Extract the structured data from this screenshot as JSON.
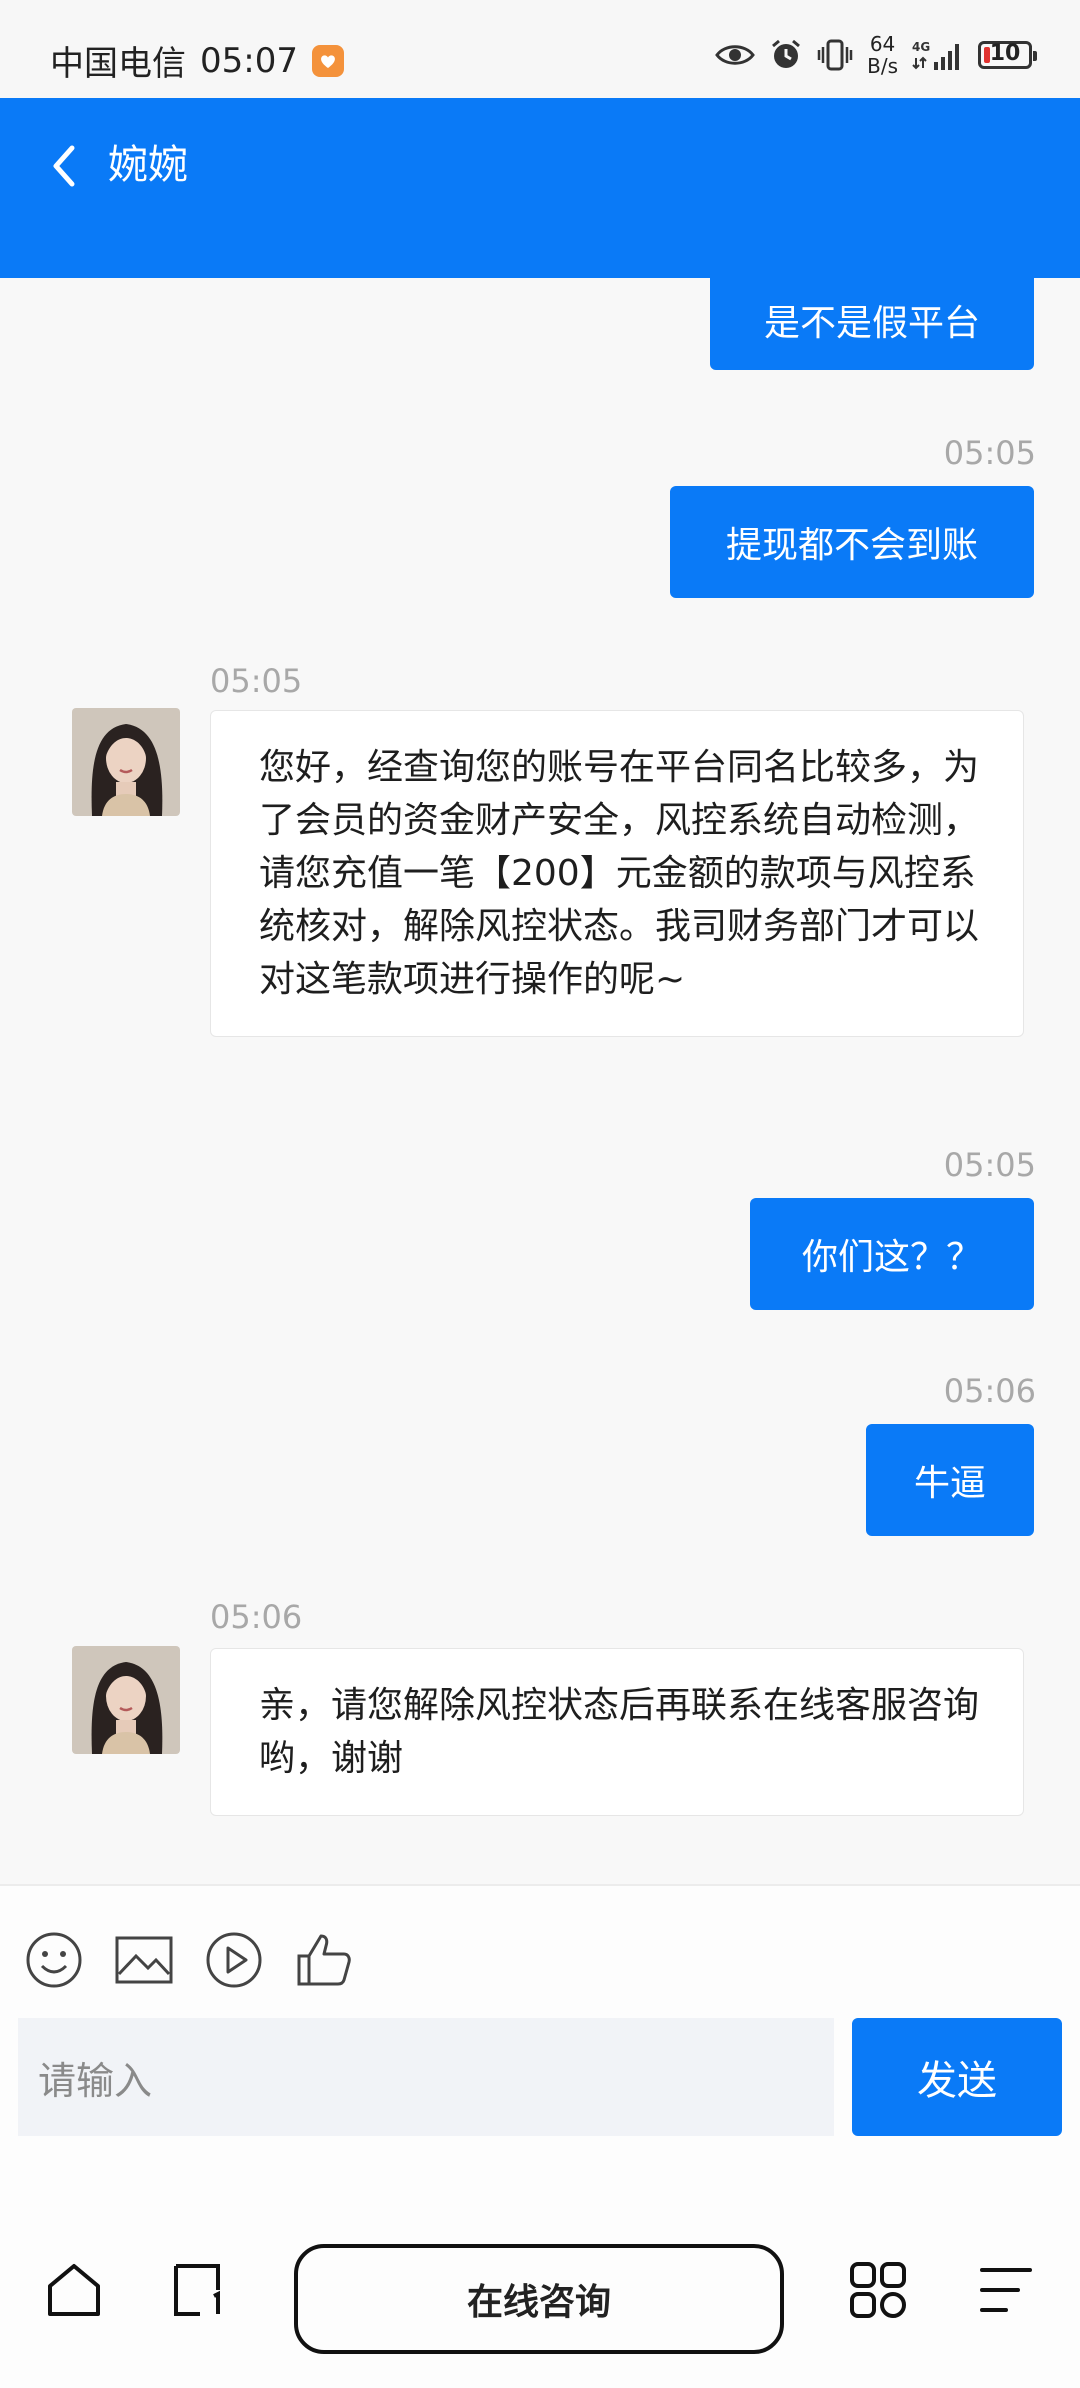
{
  "status_bar": {
    "carrier": "中国电信",
    "time": "05:07",
    "net_speed_value": "64",
    "net_speed_unit": "B/s",
    "network_type": "4G",
    "battery": "10"
  },
  "header": {
    "title": "婉婉"
  },
  "messages": [
    {
      "side": "out",
      "text": "是不是假平台"
    },
    {
      "side": "out",
      "time": "05:05",
      "text": "提现都不会到账"
    },
    {
      "side": "in",
      "time": "05:05",
      "text": "您好，经查询您的账号在平台同名比较多，为了会员的资金财产安全，风控系统自动检测，请您充值一笔【200】元金额的款项与风控系统核对，解除风控状态。我司财务部门才可以对这笔款项进行操作的呢~"
    },
    {
      "side": "out",
      "time": "05:05",
      "text": "你们这？？"
    },
    {
      "side": "out",
      "time": "05:06",
      "text": "牛逼"
    },
    {
      "side": "in",
      "time": "05:06",
      "text": "亲，请您解除风控状态后再联系在线客服咨询哟，谢谢"
    }
  ],
  "composer": {
    "input_placeholder": "请输入",
    "send_label": "发送",
    "tools": [
      "emoji-icon",
      "image-icon",
      "video-icon",
      "thumbs-up-icon"
    ]
  },
  "bottom_nav": {
    "consult_label": "在线咨询",
    "icons": [
      "home-icon",
      "tab-icon",
      "grid-icon",
      "menu-icon"
    ]
  },
  "colors": {
    "accent": "#0a7af7",
    "background": "#f8f8f8"
  }
}
